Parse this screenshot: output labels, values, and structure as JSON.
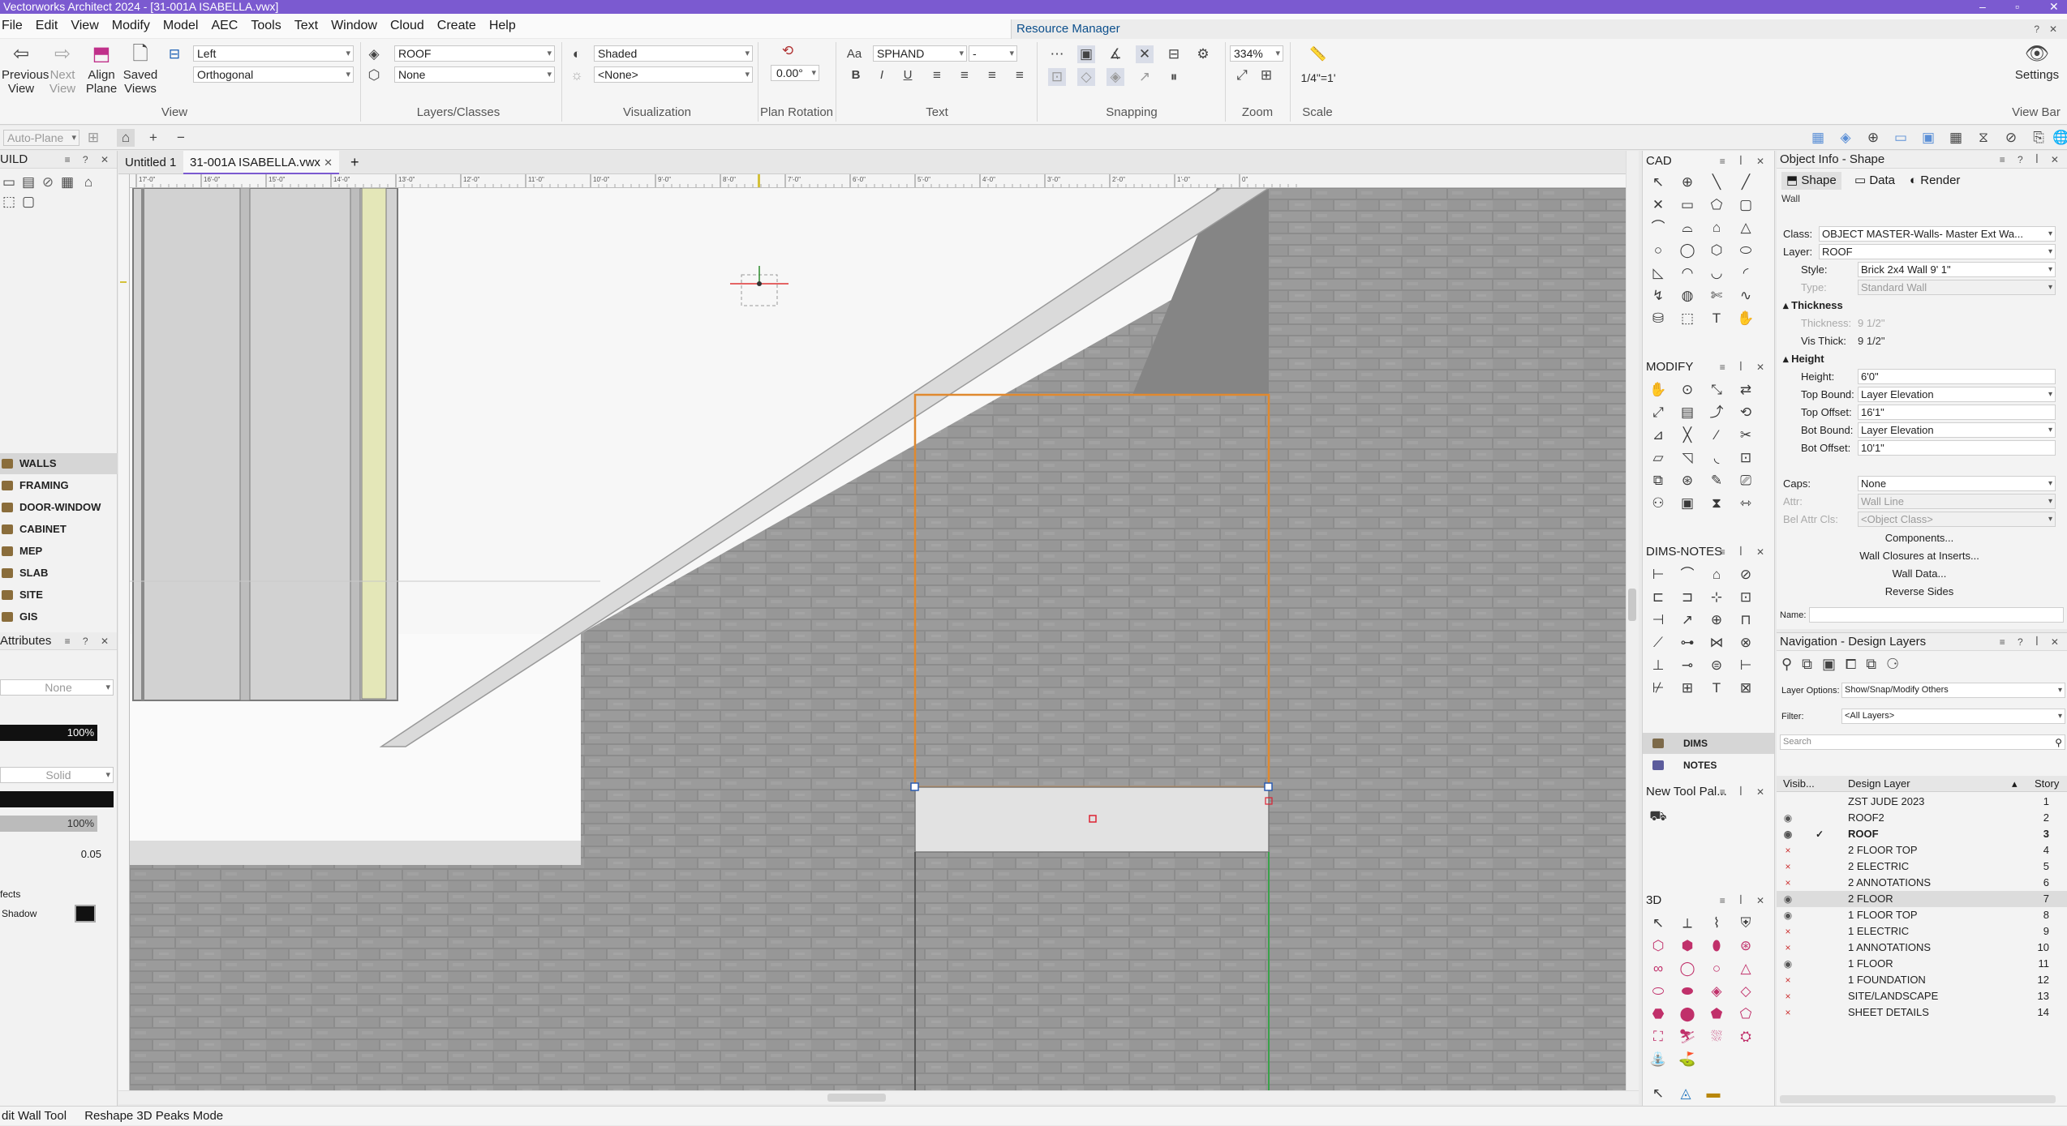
{
  "app": {
    "title": "Vectorworks Architect 2024 - [31-001A ISABELLA.vwx]"
  },
  "menu": [
    "File",
    "Edit",
    "View",
    "Modify",
    "Model",
    "AEC",
    "Tools",
    "Text",
    "Window",
    "Cloud",
    "Create",
    "Help"
  ],
  "resource_manager": "Resource Manager",
  "viewbar": {
    "previous_view": "Previous View",
    "next_view": "Next View",
    "align_plane": "Align Plane",
    "saved_views": "Saved Views",
    "view_select": "Left",
    "projection_select": "Orthogonal",
    "group_view": "View",
    "active_layer": "ROOF",
    "active_class": "None",
    "group_layers": "Layers/Classes",
    "render_mode": "Shaded",
    "light_select": "<None>",
    "group_visualization": "Visualization",
    "plan_rotation_value": "0.00°",
    "group_plan_rotation": "Plan Rotation",
    "font_name": "SPHAND",
    "font_size": "-",
    "group_text": "Text",
    "group_snapping": "Snapping",
    "zoom_value": "334%",
    "group_zoom": "Zoom",
    "scale_value": "1/4\"=1'",
    "group_scale": "Scale",
    "settings": "Settings",
    "view_bar": "View Bar"
  },
  "row2": {
    "auto_plane": "Auto-Plane"
  },
  "left_palette": {
    "title": "UILD",
    "sets": [
      "WALLS",
      "FRAMING",
      "DOOR-WINDOW",
      "CABINET",
      "MEP",
      "SLAB",
      "SITE",
      "GIS"
    ],
    "attributes": {
      "title": "Attributes",
      "fill_value": "None",
      "opacity": "100%",
      "pen_style": "Solid",
      "pen_opacity": "100%",
      "line_weight": "0.05",
      "effects_label": "fects",
      "shadow_label": "Shadow"
    }
  },
  "doc_tabs": [
    "Untitled 1",
    "31-001A ISABELLA.vwx"
  ],
  "ruler_labels": [
    "17'-0\"",
    "16'-0\"",
    "15'-0\"",
    "14'-0\"",
    "13'-0\"",
    "12'-0\"",
    "11'-0\"",
    "10'-0\"",
    "9'-0\"",
    "8'-0\"",
    "7'-0\"",
    "6'-0\"",
    "5'-0\"",
    "4'-0\"",
    "3'-0\"",
    "2'-0\"",
    "1'-0\"",
    "0\""
  ],
  "tool_palettes": {
    "cad": "CAD",
    "modify": "MODIFY",
    "dims_notes": "DIMS-NOTES",
    "dims": "DIMS",
    "notes": "NOTES",
    "new_tool_palette": "New Tool Pal...",
    "three_d": "3D"
  },
  "object_info": {
    "title": "Object Info - Shape",
    "tabs": [
      "Shape",
      "Data",
      "Render"
    ],
    "object_type": "Wall",
    "class_label": "Class:",
    "class_value": "OBJECT MASTER-Walls- Master Ext Wa...",
    "layer_label": "Layer:",
    "layer_value": "ROOF",
    "style_label": "Style:",
    "style_value": "Brick 2x4 Wall 9' 1\"",
    "type_label": "Type:",
    "type_value": "Standard Wall",
    "thickness_header": "Thickness",
    "thickness_label": "Thickness:",
    "thickness_value": "9 1/2\"",
    "vis_thick_label": "Vis Thick:",
    "vis_thick_value": "9 1/2\"",
    "height_header": "Height",
    "height_label": "Height:",
    "height_value": "6'0\"",
    "top_bound_label": "Top Bound:",
    "top_bound_value": "Layer Elevation",
    "top_offset_label": "Top Offset:",
    "top_offset_value": "16'1\"",
    "bot_bound_label": "Bot Bound:",
    "bot_bound_value": "Layer Elevation",
    "bot_offset_label": "Bot Offset:",
    "bot_offset_value": "10'1\"",
    "caps_label": "Caps:",
    "caps_value": "None",
    "attr_label": "Attr:",
    "attr_value": "Wall Line",
    "bel_attr_label": "Bel Attr Cls:",
    "bel_attr_value": "<Object Class>",
    "components_btn": "Components...",
    "closures_btn": "Wall Closures at Inserts...",
    "wall_data_btn": "Wall Data...",
    "reverse_sides_btn": "Reverse Sides",
    "name_label": "Name:"
  },
  "navigation": {
    "title": "Navigation - Design Layers",
    "layer_options_label": "Layer Options:",
    "layer_options_value": "Show/Snap/Modify Others",
    "filter_label": "Filter:",
    "filter_value": "<All Layers>",
    "search_placeholder": "Search",
    "col_visibility": "Visib...",
    "col_design_layer": "Design Layer",
    "col_story": "Story",
    "layers": [
      {
        "vis": "",
        "active": "",
        "name": "ZST JUDE 2023",
        "num": "1"
      },
      {
        "vis": "eye",
        "active": "",
        "name": "ROOF2",
        "num": "2"
      },
      {
        "vis": "eye",
        "active": "✓",
        "name": "ROOF",
        "num": "3"
      },
      {
        "vis": "x",
        "active": "",
        "name": "2 FLOOR TOP",
        "num": "4"
      },
      {
        "vis": "x",
        "active": "",
        "name": "2 ELECTRIC",
        "num": "5"
      },
      {
        "vis": "x",
        "active": "",
        "name": "2 ANNOTATIONS",
        "num": "6"
      },
      {
        "vis": "eye",
        "active": "",
        "name": "2 FLOOR",
        "num": "7"
      },
      {
        "vis": "eye",
        "active": "",
        "name": "1 FLOOR TOP",
        "num": "8"
      },
      {
        "vis": "x",
        "active": "",
        "name": "1 ELECTRIC",
        "num": "9"
      },
      {
        "vis": "x",
        "active": "",
        "name": "1 ANNOTATIONS",
        "num": "10"
      },
      {
        "vis": "eye",
        "active": "",
        "name": "1 FLOOR",
        "num": "11"
      },
      {
        "vis": "x",
        "active": "",
        "name": "1 FOUNDATION",
        "num": "12"
      },
      {
        "vis": "x",
        "active": "",
        "name": "SITE/LANDSCAPE",
        "num": "13"
      },
      {
        "vis": "x",
        "active": "",
        "name": "SHEET DETAILS",
        "num": "14"
      }
    ]
  },
  "status": {
    "tool": "dit Wall Tool",
    "mode": "Reshape 3D Peaks Mode"
  },
  "colors": {
    "accent": "#7b5ad0",
    "selection": "#e0892f",
    "brick": "#8e8e8e"
  }
}
